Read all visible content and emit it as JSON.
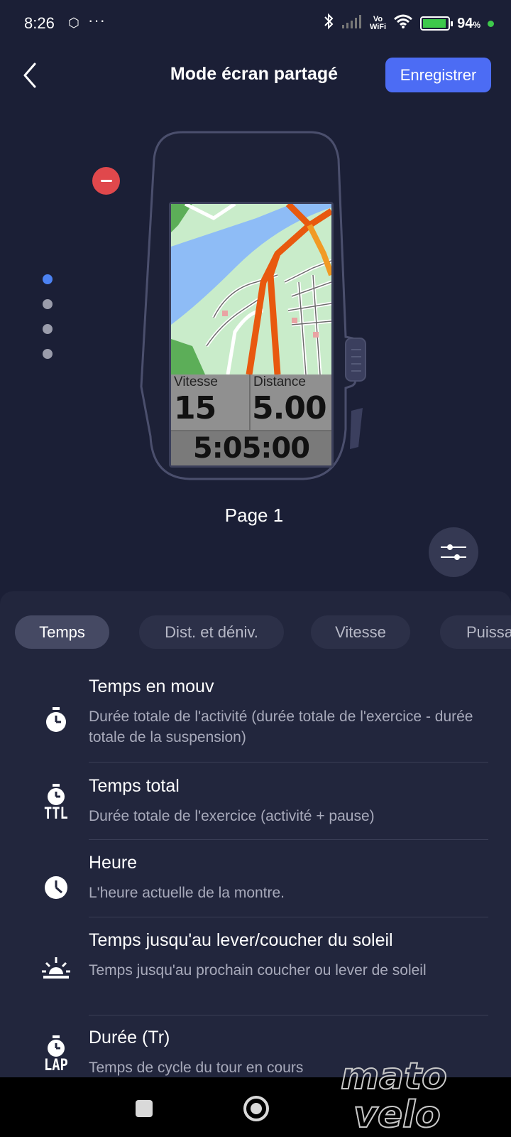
{
  "status_bar": {
    "time": "8:26",
    "dots": "···",
    "vo": "Vo",
    "wifi_label": "WiFi",
    "battery_pct": "94",
    "battery_unit": "%",
    "battery_level": 0.94
  },
  "header": {
    "title": "Mode écran partagé",
    "save_label": "Enregistrer"
  },
  "device_preview": {
    "page_label": "Page 1",
    "pages_total": 4,
    "active_page": 1,
    "fields": {
      "speed_label": "Vitesse",
      "speed_value": "15",
      "distance_label": "Distance",
      "distance_value": "5.00",
      "time_value": "5:05:00"
    }
  },
  "tabs": [
    {
      "label": "Temps",
      "active": true
    },
    {
      "label": "Dist. et déniv.",
      "active": false
    },
    {
      "label": "Vitesse",
      "active": false
    },
    {
      "label": "Puissa",
      "active": false
    }
  ],
  "metrics": [
    {
      "icon": "stopwatch-icon",
      "title": "Temps en mouv",
      "desc": "Durée totale de l'activité (durée totale de l'exercice - durée totale de la suspension)"
    },
    {
      "icon": "stopwatch-ttl-icon",
      "icon_text": "TTL",
      "title": "Temps total",
      "desc": "Durée totale de l'exercice (activité + pause)"
    },
    {
      "icon": "clock-icon",
      "title": "Heure",
      "desc": "L'heure actuelle de la montre."
    },
    {
      "icon": "sunrise-icon",
      "title": "Temps jusqu'au lever/coucher du soleil",
      "desc": "Temps jusqu'au prochain coucher ou lever de soleil"
    },
    {
      "icon": "stopwatch-lap-icon",
      "icon_text": "LAP",
      "title": "Durée (Tr)",
      "desc": "Temps de cycle du tour en cours"
    }
  ],
  "watermark": {
    "line1": "mato",
    "line2": "velo"
  },
  "colors": {
    "background": "#1b1f36",
    "sheet": "#22263d",
    "accent": "#4c6cf4",
    "delete": "#e0484c",
    "active_dot": "#4c82f2"
  }
}
